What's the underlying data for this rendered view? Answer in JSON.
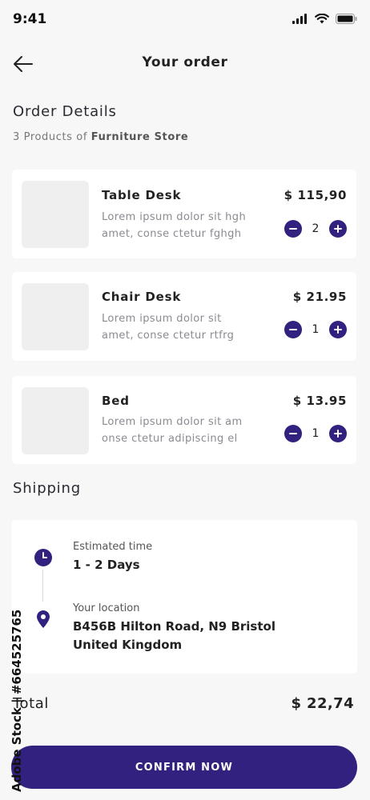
{
  "status_bar": {
    "time": "9:41"
  },
  "header": {
    "title": "Your order"
  },
  "order_details": {
    "title": "Order Details",
    "subtitle_prefix": "3 Products of ",
    "store_name": "Furniture Store"
  },
  "products": [
    {
      "name": "Table Desk",
      "description": "Lorem ipsum dolor sit hgh\namet, conse ctetur fghgh",
      "price": "$ 115,90",
      "quantity": "2"
    },
    {
      "name": "Chair Desk",
      "description": "Lorem ipsum dolor sit\namet, conse ctetur  rtfrg",
      "price": "$ 21.95",
      "quantity": "1"
    },
    {
      "name": "Bed",
      "description": "Lorem ipsum dolor sit am\nonse ctetur adipiscing el",
      "price": "$ 13.95",
      "quantity": "1"
    }
  ],
  "shipping": {
    "title": "Shipping",
    "estimated_label": "Estimated time",
    "estimated_value": "1 - 2 Days",
    "location_label": "Your location",
    "location_value": "B456B Hilton Road, N9 Bristol\nUnited Kingdom"
  },
  "total": {
    "label": "Total",
    "value": "$ 22,74"
  },
  "confirm_button": {
    "label": "CONFIRM NOW"
  },
  "watermark": {
    "text": "Adobe Stock | #664525765"
  },
  "colors": {
    "accent": "#32217e",
    "background": "#f7f7f8",
    "card": "#ffffff"
  }
}
